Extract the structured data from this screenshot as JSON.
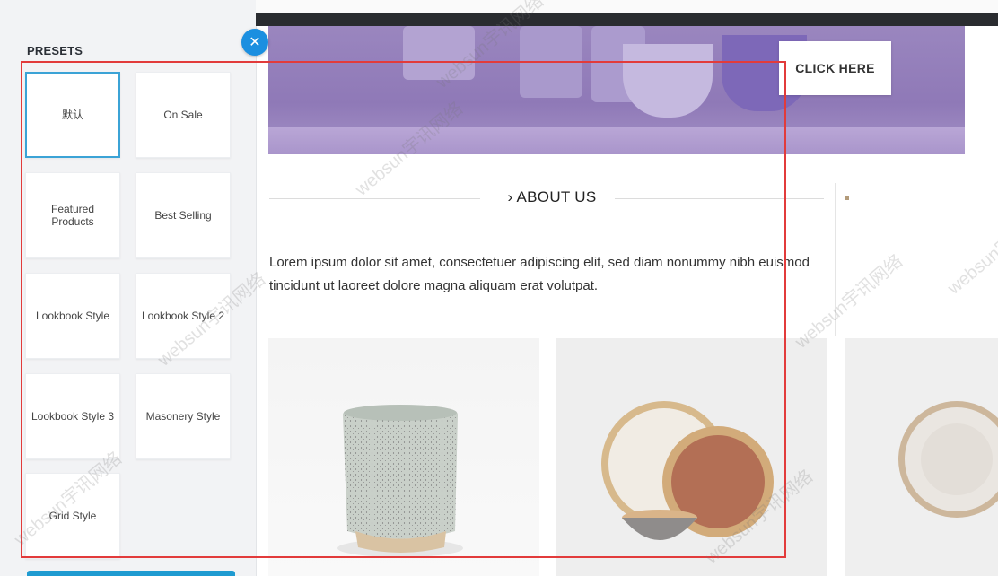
{
  "panel": {
    "title": "PRESETS",
    "presets": [
      {
        "label": "默认",
        "active": true
      },
      {
        "label": "On Sale"
      },
      {
        "label": "Featured Products"
      },
      {
        "label": "Best Selling"
      },
      {
        "label": "Lookbook Style"
      },
      {
        "label": "Lookbook Style 2"
      },
      {
        "label": "Lookbook Style 3"
      },
      {
        "label": "Masonery Style"
      },
      {
        "label": "Grid Style"
      }
    ],
    "close_icon": "close-icon",
    "accent": "#1b8fe0"
  },
  "hero": {
    "cta_label": "CLICK HERE",
    "background": "#9a86bf"
  },
  "about": {
    "heading": "ABOUT US",
    "text": "Lorem ipsum dolor sit amet, consectetuer adipiscing elit, sed diam nonummy nibh euismod tincidunt ut laoreet dolore magna aliquam erat volutpat."
  },
  "products": [
    {
      "name": "speckled-cup-image"
    },
    {
      "name": "plates-and-bowl-image"
    },
    {
      "name": "white-plate-image"
    }
  ],
  "annotation_color": "#e23b3b",
  "watermark": "websun宇讯网络"
}
